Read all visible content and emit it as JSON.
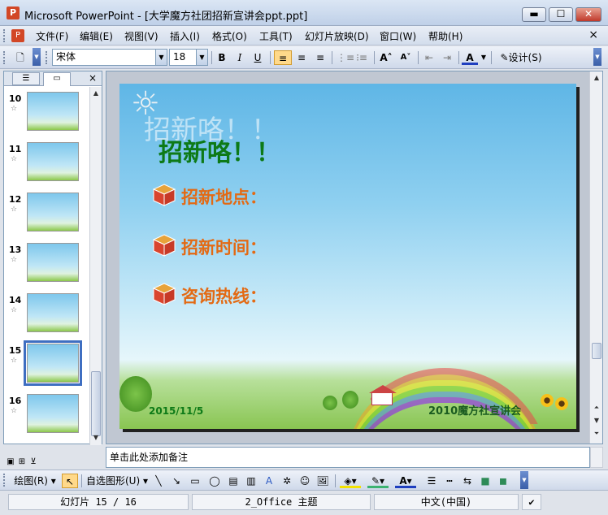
{
  "window": {
    "title": "Microsoft PowerPoint - [大学魔方社团招新宣讲会ppt.ppt]",
    "app_icon_letter": "P",
    "min_label": "▬",
    "max_label": "☐",
    "close_label": "✕"
  },
  "menu": {
    "items": [
      "文件(F)",
      "编辑(E)",
      "视图(V)",
      "插入(I)",
      "格式(O)",
      "工具(T)",
      "幻灯片放映(D)",
      "窗口(W)",
      "帮助(H)"
    ],
    "close_label": "×"
  },
  "toolbar": {
    "font_name": "宋体",
    "font_size": "18",
    "bold": "B",
    "italic": "I",
    "underline": "U",
    "design_label": "设计(S)"
  },
  "left_pane": {
    "tab_outline_icon": "outline-icon",
    "tab_slides_icon": "slides-icon",
    "close_label": "×",
    "slides": [
      {
        "num": "10",
        "selected": false
      },
      {
        "num": "11",
        "selected": false
      },
      {
        "num": "12",
        "selected": false
      },
      {
        "num": "13",
        "selected": false
      },
      {
        "num": "14",
        "selected": false
      },
      {
        "num": "15",
        "selected": true
      },
      {
        "num": "16",
        "selected": false
      }
    ],
    "star": "☆"
  },
  "slide": {
    "ghost_title": "招新咯！！",
    "title": "招新咯！！",
    "bullets": [
      "招新地点：",
      "招新时间：",
      "咨询热线："
    ],
    "date": "2015/11/5",
    "org": "2010魔方社宣讲会",
    "title_color": "#0d7a17",
    "bullet_color": "#e36a14"
  },
  "notes": {
    "placeholder": "单击此处添加备注"
  },
  "drawing": {
    "draw_label": "绘图(R)",
    "autoshapes_label": "自选图形(U)"
  },
  "status": {
    "slide_info": "幻灯片 15 / 16",
    "theme": "2_Office 主题",
    "language": "中文(中国)"
  }
}
